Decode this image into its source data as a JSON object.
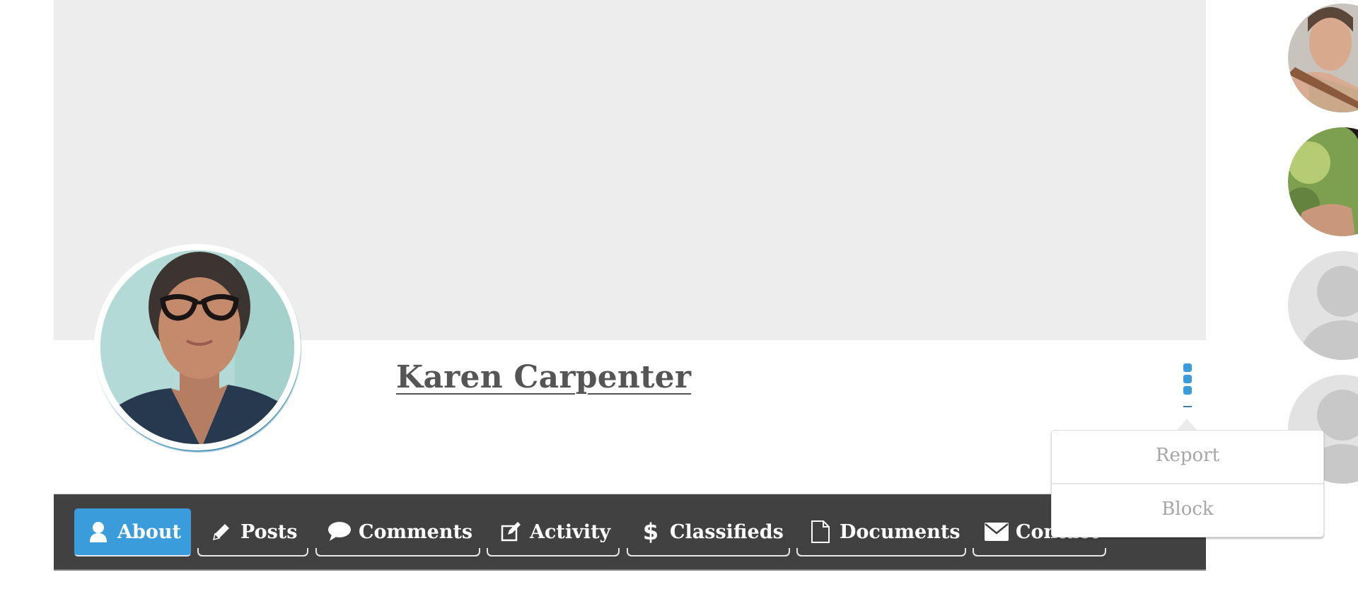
{
  "profile": {
    "name": "Karen Carpenter",
    "avatar_alt": "profile-photo-woman-glasses"
  },
  "menu": {
    "icon": "kebab-vertical-icon",
    "items": [
      {
        "label": "Report"
      },
      {
        "label": "Block"
      }
    ]
  },
  "nav": {
    "active_index": 0,
    "tabs": [
      {
        "label": "About",
        "icon": "user-icon"
      },
      {
        "label": "Posts",
        "icon": "pencil-icon"
      },
      {
        "label": "Comments",
        "icon": "speech-bubble-icon"
      },
      {
        "label": "Activity",
        "icon": "edit-square-icon"
      },
      {
        "label": "Classifieds",
        "icon": "dollar-icon"
      },
      {
        "label": "Documents",
        "icon": "document-icon"
      },
      {
        "label": "Contact",
        "icon": "envelope-icon"
      }
    ]
  },
  "suggestions": [
    {
      "type": "photo",
      "alt": "woman-with-bag-strap"
    },
    {
      "type": "photo",
      "alt": "woman-with-dark-hair-outdoors"
    },
    {
      "type": "placeholder",
      "alt": "default-avatar"
    },
    {
      "type": "placeholder",
      "alt": "default-avatar"
    }
  ],
  "colors": {
    "accent": "#3b9cdc",
    "nav_bg": "#414141",
    "cover_bg": "#ededed",
    "name_text": "#555555",
    "menu_text": "#a6a6a6"
  }
}
